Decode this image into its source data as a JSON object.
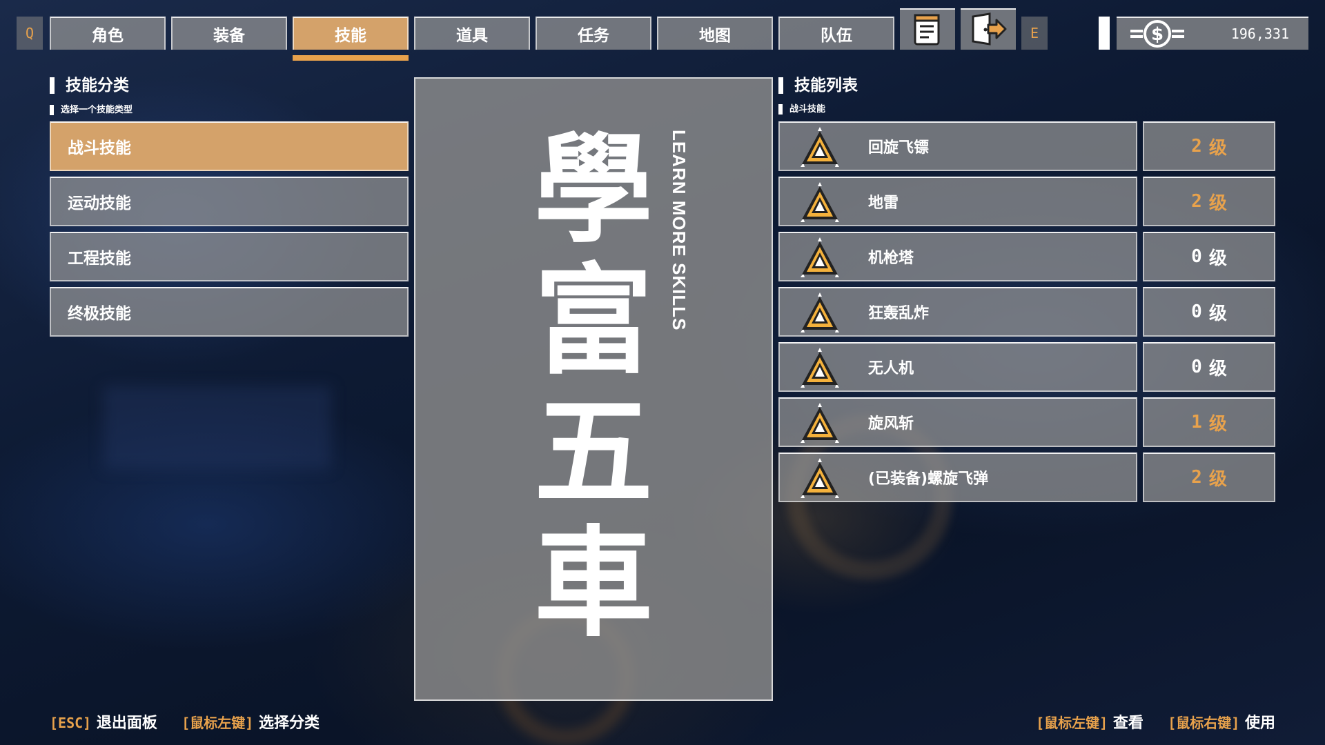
{
  "nav": {
    "left_key": "Q",
    "right_key": "E",
    "tabs": [
      {
        "label": "角色"
      },
      {
        "label": "装备"
      },
      {
        "label": "技能"
      },
      {
        "label": "道具"
      },
      {
        "label": "任务"
      },
      {
        "label": "地图"
      },
      {
        "label": "队伍"
      }
    ],
    "active_tab": "技能",
    "icons": [
      "notes-icon",
      "exit-door-icon"
    ]
  },
  "currency": {
    "icon": "dollar-coin-icon",
    "value": "196,331"
  },
  "category_panel": {
    "title": "技能分类",
    "subtitle": "选择一个技能类型",
    "items": [
      {
        "label": "战斗技能"
      },
      {
        "label": "运动技能"
      },
      {
        "label": "工程技能"
      },
      {
        "label": "终极技能"
      }
    ],
    "active": "战斗技能"
  },
  "banner": {
    "chars": [
      "學",
      "富",
      "五",
      "車"
    ],
    "subtitle_en": "LEARN MORE SKILLS"
  },
  "skill_panel": {
    "title": "技能列表",
    "subtitle": "战斗技能",
    "skills": [
      {
        "name": "回旋飞镖",
        "level": "2",
        "unit": "级",
        "learned": true
      },
      {
        "name": "地雷",
        "level": "2",
        "unit": "级",
        "learned": true
      },
      {
        "name": "机枪塔",
        "level": "0",
        "unit": "级",
        "learned": false
      },
      {
        "name": "狂轰乱炸",
        "level": "0",
        "unit": "级",
        "learned": false
      },
      {
        "name": "无人机",
        "level": "0",
        "unit": "级",
        "learned": false
      },
      {
        "name": "旋风斩",
        "level": "1",
        "unit": "级",
        "learned": true
      },
      {
        "name": "(已装备)螺旋飞弹",
        "level": "2",
        "unit": "级",
        "learned": true
      }
    ]
  },
  "footer": {
    "left": [
      {
        "key": "[ESC]",
        "action": "退出面板"
      },
      {
        "key": "[鼠标左键]",
        "action": "选择分类"
      }
    ],
    "right": [
      {
        "key": "[鼠标左键]",
        "action": "查看"
      },
      {
        "key": "[鼠标右键]",
        "action": "使用"
      }
    ]
  },
  "colors": {
    "accent": "#e8a24c",
    "active_bg": "#d4a26a",
    "panel_bg": "#969696",
    "unlearned_level": "#ffffff"
  }
}
